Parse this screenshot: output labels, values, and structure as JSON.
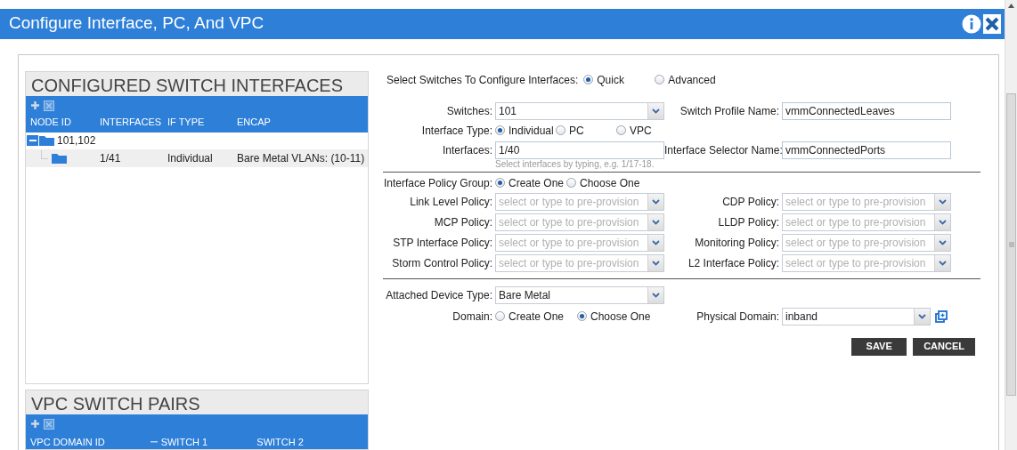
{
  "title": "Configure Interface, PC, And VPC",
  "configured_panel": {
    "heading": "CONFIGURED SWITCH INTERFACES",
    "columns": [
      "NODE ID",
      "INTERFACES",
      "IF TYPE",
      "ENCAP"
    ],
    "groups": [
      {
        "label": "101,102",
        "expanded": true,
        "children": [
          {
            "cells": [
              "1/41",
              "Individual",
              "Bare Metal VLANs: (10-11)"
            ],
            "selected": true
          }
        ]
      }
    ]
  },
  "vpc_panel": {
    "heading": "VPC SWITCH PAIRS",
    "columns": [
      {
        "label": "VPC DOMAIN ID",
        "sorted": false
      },
      {
        "label": "SWITCH 1",
        "sorted": true
      },
      {
        "label": "SWITCH 2",
        "sorted": false
      }
    ]
  },
  "form": {
    "switch_select": {
      "label": "Select Switches To Configure Interfaces:",
      "options": [
        {
          "label": "Quick",
          "selected": true
        },
        {
          "label": "Advanced",
          "selected": false
        }
      ]
    },
    "switches": {
      "label": "Switches:",
      "value": "101"
    },
    "switch_profile": {
      "label": "Switch Profile Name:",
      "value": "vmmConnectedLeaves"
    },
    "interface_type": {
      "label": "Interface Type:",
      "options": [
        {
          "label": "Individual",
          "selected": true
        },
        {
          "label": "PC",
          "selected": false
        },
        {
          "label": "VPC",
          "selected": false
        }
      ]
    },
    "interfaces": {
      "label": "Interfaces:",
      "value": "1/40",
      "hint": "Select interfaces by typing, e.g. 1/17-18."
    },
    "selector_name": {
      "label": "Interface Selector Name:",
      "value": "vmmConnectedPorts"
    },
    "policy_group": {
      "label": "Interface Policy Group:",
      "options": [
        {
          "label": "Create One",
          "selected": true
        },
        {
          "label": "Choose One",
          "selected": false
        }
      ]
    },
    "policies": [
      {
        "label": "Link Level Policy:",
        "placeholder": "select or type to pre-provision"
      },
      {
        "label": "CDP Policy:",
        "placeholder": "select or type to pre-provision"
      },
      {
        "label": "MCP Policy:",
        "placeholder": "select or type to pre-provision"
      },
      {
        "label": "LLDP Policy:",
        "placeholder": "select or type to pre-provision"
      },
      {
        "label": "STP Interface Policy:",
        "placeholder": "select or type to pre-provision"
      },
      {
        "label": "Monitoring Policy:",
        "placeholder": "select or type to pre-provision"
      },
      {
        "label": "Storm Control Policy:",
        "placeholder": "select or type to pre-provision"
      },
      {
        "label": "L2 Interface Policy:",
        "placeholder": "select or type to pre-provision"
      }
    ],
    "attached_device_type": {
      "label": "Attached Device Type:",
      "value": "Bare Metal"
    },
    "domain": {
      "label": "Domain:",
      "options": [
        {
          "label": "Create One",
          "selected": false
        },
        {
          "label": "Choose One",
          "selected": true
        }
      ]
    },
    "physical_domain": {
      "label": "Physical Domain:",
      "value": "inband"
    },
    "buttons": [
      "SAVE",
      "CANCEL"
    ]
  }
}
